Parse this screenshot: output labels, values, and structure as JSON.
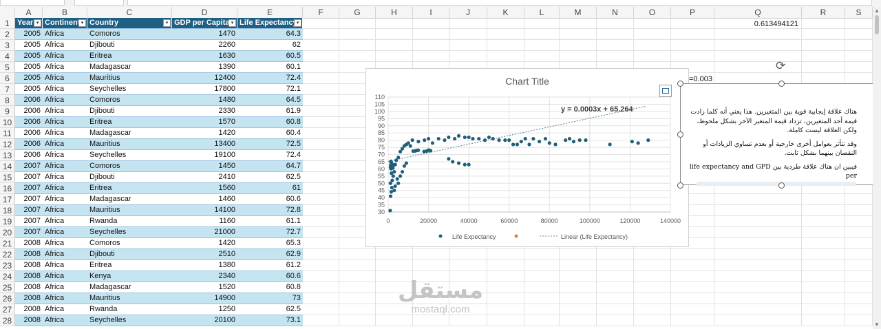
{
  "columns": [
    "A",
    "B",
    "C",
    "D",
    "E",
    "F",
    "G",
    "H",
    "I",
    "J",
    "K",
    "L",
    "M",
    "N",
    "O",
    "P",
    "Q",
    "R",
    "S"
  ],
  "table": {
    "headers": [
      "Year",
      "Continent",
      "Country",
      "GDP per Capita",
      "Life Expectancy"
    ],
    "rows": [
      [
        "2005",
        "Africa",
        "Comoros",
        "1470",
        "64.3"
      ],
      [
        "2005",
        "Africa",
        "Djibouti",
        "2260",
        "62"
      ],
      [
        "2005",
        "Africa",
        "Eritrea",
        "1630",
        "60.5"
      ],
      [
        "2005",
        "Africa",
        "Madagascar",
        "1390",
        "60.1"
      ],
      [
        "2005",
        "Africa",
        "Mauritius",
        "12400",
        "72.4"
      ],
      [
        "2005",
        "Africa",
        "Seychelles",
        "17800",
        "72.1"
      ],
      [
        "2006",
        "Africa",
        "Comoros",
        "1480",
        "64.5"
      ],
      [
        "2006",
        "Africa",
        "Djibouti",
        "2330",
        "61.9"
      ],
      [
        "2006",
        "Africa",
        "Eritrea",
        "1570",
        "60.8"
      ],
      [
        "2006",
        "Africa",
        "Madagascar",
        "1420",
        "60.4"
      ],
      [
        "2006",
        "Africa",
        "Mauritius",
        "13400",
        "72.5"
      ],
      [
        "2006",
        "Africa",
        "Seychelles",
        "19100",
        "72.4"
      ],
      [
        "2007",
        "Africa",
        "Comoros",
        "1450",
        "64.7"
      ],
      [
        "2007",
        "Africa",
        "Djibouti",
        "2410",
        "62.5"
      ],
      [
        "2007",
        "Africa",
        "Eritrea",
        "1560",
        "61"
      ],
      [
        "2007",
        "Africa",
        "Madagascar",
        "1460",
        "60.6"
      ],
      [
        "2007",
        "Africa",
        "Mauritius",
        "14100",
        "72.8"
      ],
      [
        "2007",
        "Africa",
        "Rwanda",
        "1160",
        "61.1"
      ],
      [
        "2007",
        "Africa",
        "Seychelles",
        "21000",
        "72.7"
      ],
      [
        "2008",
        "Africa",
        "Comoros",
        "1420",
        "65.3"
      ],
      [
        "2008",
        "Africa",
        "Djibouti",
        "2510",
        "62.9"
      ],
      [
        "2008",
        "Africa",
        "Eritrea",
        "1380",
        "61.2"
      ],
      [
        "2008",
        "Africa",
        "Kenya",
        "2340",
        "60.6"
      ],
      [
        "2008",
        "Africa",
        "Madagascar",
        "1520",
        "60.8"
      ],
      [
        "2008",
        "Africa",
        "Mauritius",
        "14900",
        "73"
      ],
      [
        "2008",
        "Africa",
        "Rwanda",
        "1250",
        "62.5"
      ],
      [
        "2008",
        "Africa",
        "Seychelles",
        "20100",
        "73.1"
      ]
    ]
  },
  "cells": {
    "q1_value": "0.613494121",
    "p_equation_fragment": "=0.003"
  },
  "textbox": {
    "paragraphs": [
      "هناك علاقة إيجابية قوية بين المتغيرين. هذا يعني أنه كلما زادت قيمة أحد المتغيرين، تزداد قيمة المتغير الآخر بشكل ملحوظ، ولكن العلاقة ليست كاملة.",
      "وقد تتأثر بعوامل أخرى خارجية أو بعدم تساوي الزيادات أو النقصان بينهما بشكل ثابت.",
      "فيبين ان هناك علاقة طردية بين life expectancy and GPD per"
    ]
  },
  "watermark": {
    "arabic": "مستقل",
    "latin": "mostaql.com"
  },
  "chart_data": {
    "type": "scatter",
    "title": "Chart Title",
    "xlabel": "",
    "ylabel": "",
    "xlim": [
      0,
      140000
    ],
    "ylim": [
      30,
      110
    ],
    "x_ticks": [
      "0",
      "20000",
      "40000",
      "60000",
      "80000",
      "100000",
      "120000",
      "140000"
    ],
    "y_ticks": [
      "30",
      "35",
      "40",
      "45",
      "50",
      "55",
      "60",
      "65",
      "70",
      "75",
      "80",
      "85",
      "90",
      "95",
      "100",
      "105",
      "110"
    ],
    "grid": true,
    "legend_position": "bottom",
    "legend": [
      "Life Expectancy",
      "",
      "Linear (Life Expectancy)"
    ],
    "series": [
      {
        "name": "Life Expectancy",
        "color": "#1f5f7a",
        "points": [
          [
            1470,
            64.3
          ],
          [
            2260,
            62
          ],
          [
            1630,
            60.5
          ],
          [
            1390,
            60.1
          ],
          [
            12400,
            72.4
          ],
          [
            17800,
            72.1
          ],
          [
            1480,
            64.5
          ],
          [
            2330,
            61.9
          ],
          [
            1570,
            60.8
          ],
          [
            1420,
            60.4
          ],
          [
            13400,
            72.5
          ],
          [
            19100,
            72.4
          ],
          [
            1450,
            64.7
          ],
          [
            2410,
            62.5
          ],
          [
            1560,
            61
          ],
          [
            1460,
            60.6
          ],
          [
            14100,
            72.8
          ],
          [
            1160,
            61.1
          ],
          [
            21000,
            72.7
          ],
          [
            1420,
            65.3
          ],
          [
            2510,
            62.9
          ],
          [
            1380,
            61.2
          ],
          [
            2340,
            60.6
          ],
          [
            1520,
            60.8
          ],
          [
            14900,
            73
          ],
          [
            1250,
            62.5
          ],
          [
            20100,
            73.1
          ],
          [
            1000,
            31
          ],
          [
            1200,
            41
          ],
          [
            1500,
            44
          ],
          [
            1800,
            47
          ],
          [
            2000,
            52
          ],
          [
            2500,
            55
          ],
          [
            1100,
            50
          ],
          [
            1600,
            57
          ],
          [
            3000,
            58
          ],
          [
            3500,
            63
          ],
          [
            4000,
            66
          ],
          [
            5000,
            68
          ],
          [
            6000,
            72
          ],
          [
            7000,
            74
          ],
          [
            8000,
            76
          ],
          [
            9000,
            77
          ],
          [
            10000,
            78
          ],
          [
            11000,
            76
          ],
          [
            12000,
            80
          ],
          [
            15000,
            79
          ],
          [
            18000,
            80
          ],
          [
            20000,
            81
          ],
          [
            22000,
            78
          ],
          [
            25000,
            81
          ],
          [
            28000,
            80
          ],
          [
            30000,
            82
          ],
          [
            33000,
            81
          ],
          [
            35000,
            83
          ],
          [
            38000,
            82
          ],
          [
            40000,
            82
          ],
          [
            42000,
            81
          ],
          [
            45000,
            81
          ],
          [
            48000,
            80
          ],
          [
            50000,
            82
          ],
          [
            52000,
            81
          ],
          [
            55000,
            80
          ],
          [
            58000,
            80
          ],
          [
            60000,
            80
          ],
          [
            62000,
            77
          ],
          [
            64000,
            77
          ],
          [
            66000,
            79
          ],
          [
            68000,
            81
          ],
          [
            70000,
            77
          ],
          [
            72000,
            81
          ],
          [
            75000,
            79
          ],
          [
            78000,
            81
          ],
          [
            80000,
            78
          ],
          [
            83000,
            77
          ],
          [
            88000,
            80
          ],
          [
            90000,
            81
          ],
          [
            92000,
            79
          ],
          [
            95000,
            80
          ],
          [
            98000,
            80
          ],
          [
            110000,
            77
          ],
          [
            121000,
            79
          ],
          [
            124000,
            78
          ],
          [
            129000,
            80
          ],
          [
            30000,
            67
          ],
          [
            32000,
            65
          ],
          [
            35000,
            64
          ],
          [
            38000,
            63
          ],
          [
            40000,
            63
          ],
          [
            6000,
            55
          ],
          [
            7000,
            58
          ],
          [
            8000,
            62
          ],
          [
            9000,
            64
          ],
          [
            5000,
            50
          ],
          [
            4500,
            53
          ],
          [
            3000,
            45
          ],
          [
            3500,
            48
          ]
        ]
      }
    ],
    "trendline": {
      "label": "y = 0.0003x + 65.264",
      "slope": 0.0003,
      "intercept": 65.264,
      "color": "#4e7d8f"
    }
  }
}
